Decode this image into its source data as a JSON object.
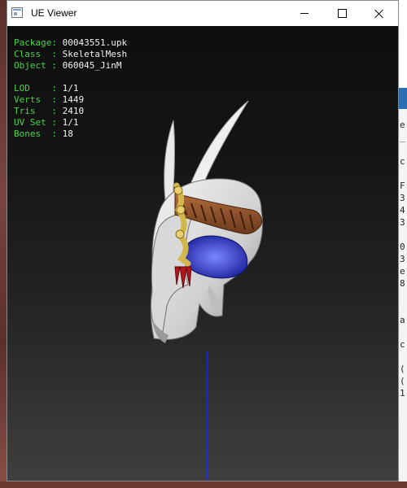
{
  "window": {
    "title": "UE Viewer",
    "controls": {
      "minimize": "minimize",
      "maximize": "maximize",
      "close": "close"
    }
  },
  "info": {
    "package_label": "Package: ",
    "package_value": "00043551.upk",
    "class_label": "Class  : ",
    "class_value": "SkeletalMesh",
    "object_label": "Object : ",
    "object_value": "060045_JinM",
    "lod_label": "LOD    : ",
    "lod_value": "1/1",
    "verts_label": "Verts  : ",
    "verts_value": "1449",
    "tris_label": "Tris   : ",
    "tris_value": "2410",
    "uvset_label": "UV Set : ",
    "uvset_value": "1/1",
    "bones_label": "Bones  : ",
    "bones_value": "18"
  },
  "background_glyphs": "e\n_\n\nc\n\nF\n3\n4\n3\n\n0\n3\ne\n8\n\n\na\n\nc\n\n(\n(\n1",
  "colors": {
    "label": "#49d44a",
    "value": "#f2f2f2",
    "axis": "#1f2bd6",
    "titlebar": "#ffffff"
  }
}
